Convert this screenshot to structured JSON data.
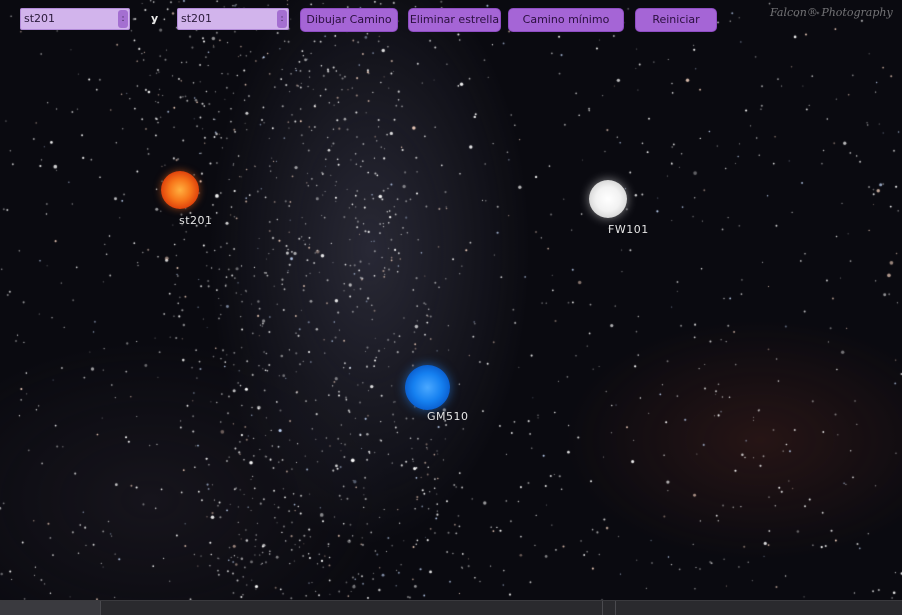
{
  "toolbar": {
    "origin_select_value": "st201",
    "connector_label": "y",
    "destination_select_value": "st201",
    "draw_path_label": "Dibujar Camino",
    "delete_star_label": "Eliminar estrella",
    "min_path_label": "Camino mínimo",
    "reset_label": "Reiniciar"
  },
  "watermark": "Falcon® Photography",
  "stars": [
    {
      "label": "st201",
      "color": "#f05a14"
    },
    {
      "label": "FW101",
      "color": "#f4f4f4"
    },
    {
      "label": "GM510",
      "color": "#1a82f0"
    }
  ],
  "colors": {
    "select_bg": "#d2b4ec",
    "button_bg": "#a565d6",
    "sky": "#0a0a10"
  }
}
